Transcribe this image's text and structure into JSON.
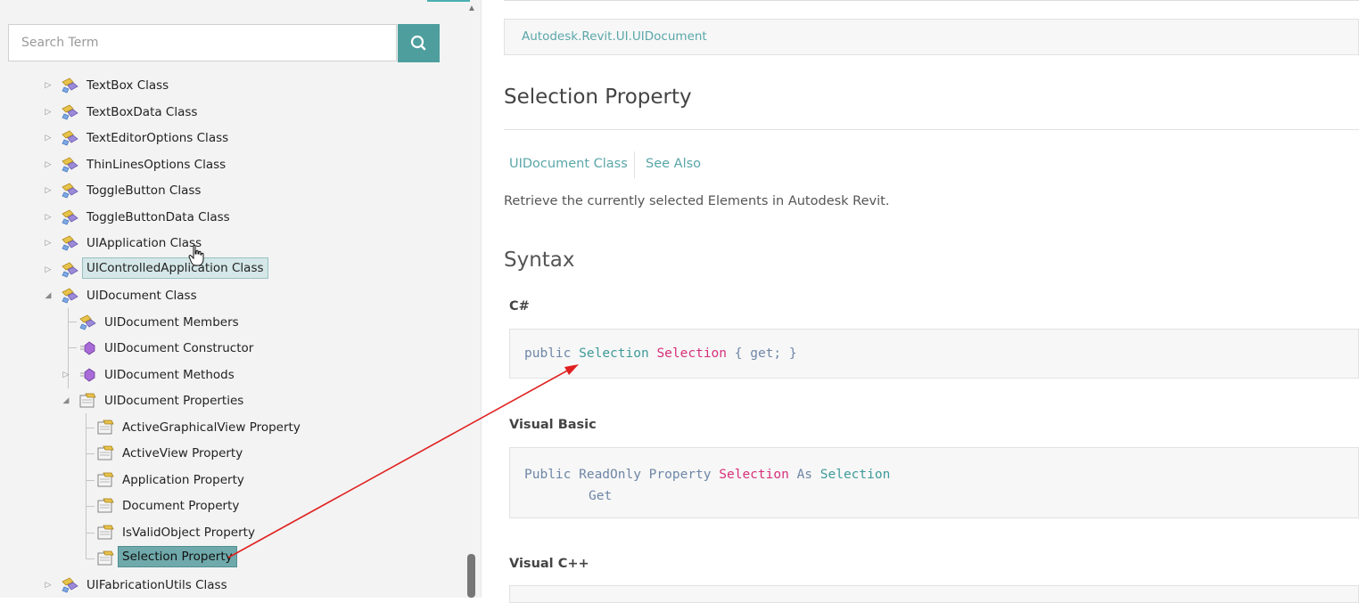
{
  "search": {
    "placeholder": "Search Term"
  },
  "tree": {
    "items": [
      {
        "label": "TextBox Class"
      },
      {
        "label": "TextBoxData Class"
      },
      {
        "label": "TextEditorOptions Class"
      },
      {
        "label": "ThinLinesOptions Class"
      },
      {
        "label": "ToggleButton Class"
      },
      {
        "label": "ToggleButtonData Class"
      },
      {
        "label": "UIApplication Class"
      },
      {
        "label": "UIControlledApplication Class"
      },
      {
        "label": "UIDocument Class"
      },
      {
        "label": "UIDocument Members"
      },
      {
        "label": "UIDocument Constructor"
      },
      {
        "label": "UIDocument Methods"
      },
      {
        "label": "UIDocument Properties"
      },
      {
        "label": "ActiveGraphicalView Property"
      },
      {
        "label": "ActiveView Property"
      },
      {
        "label": "Application Property"
      },
      {
        "label": "Document Property"
      },
      {
        "label": "IsValidObject Property"
      },
      {
        "label": "Selection Property"
      },
      {
        "label": "UIFabricationUtils Class"
      }
    ]
  },
  "content": {
    "breadcrumb": "Autodesk.Revit.UI.UIDocument",
    "title": "Selection Property",
    "tabs": {
      "class": "UIDocument Class",
      "see_also": "See Also"
    },
    "summary": "Retrieve the currently selected Elements in Autodesk Revit.",
    "syntax_heading": "Syntax",
    "csharp": {
      "heading": "C#",
      "public": "public",
      "type": "Selection",
      "name": "Selection",
      "rest": "{ get; }"
    },
    "vb": {
      "heading": "Visual Basic",
      "prefix": "Public ReadOnly Property",
      "name": "Selection",
      "as": "As",
      "type": "Selection",
      "get": "Get"
    },
    "cpp": {
      "heading": "Visual C++"
    }
  },
  "colors": {
    "accent": "#4e9e9e",
    "link": "#5aa6a8",
    "code_type": "#3f9a9a",
    "code_name": "#d6307a",
    "arrow": "#e02020"
  }
}
